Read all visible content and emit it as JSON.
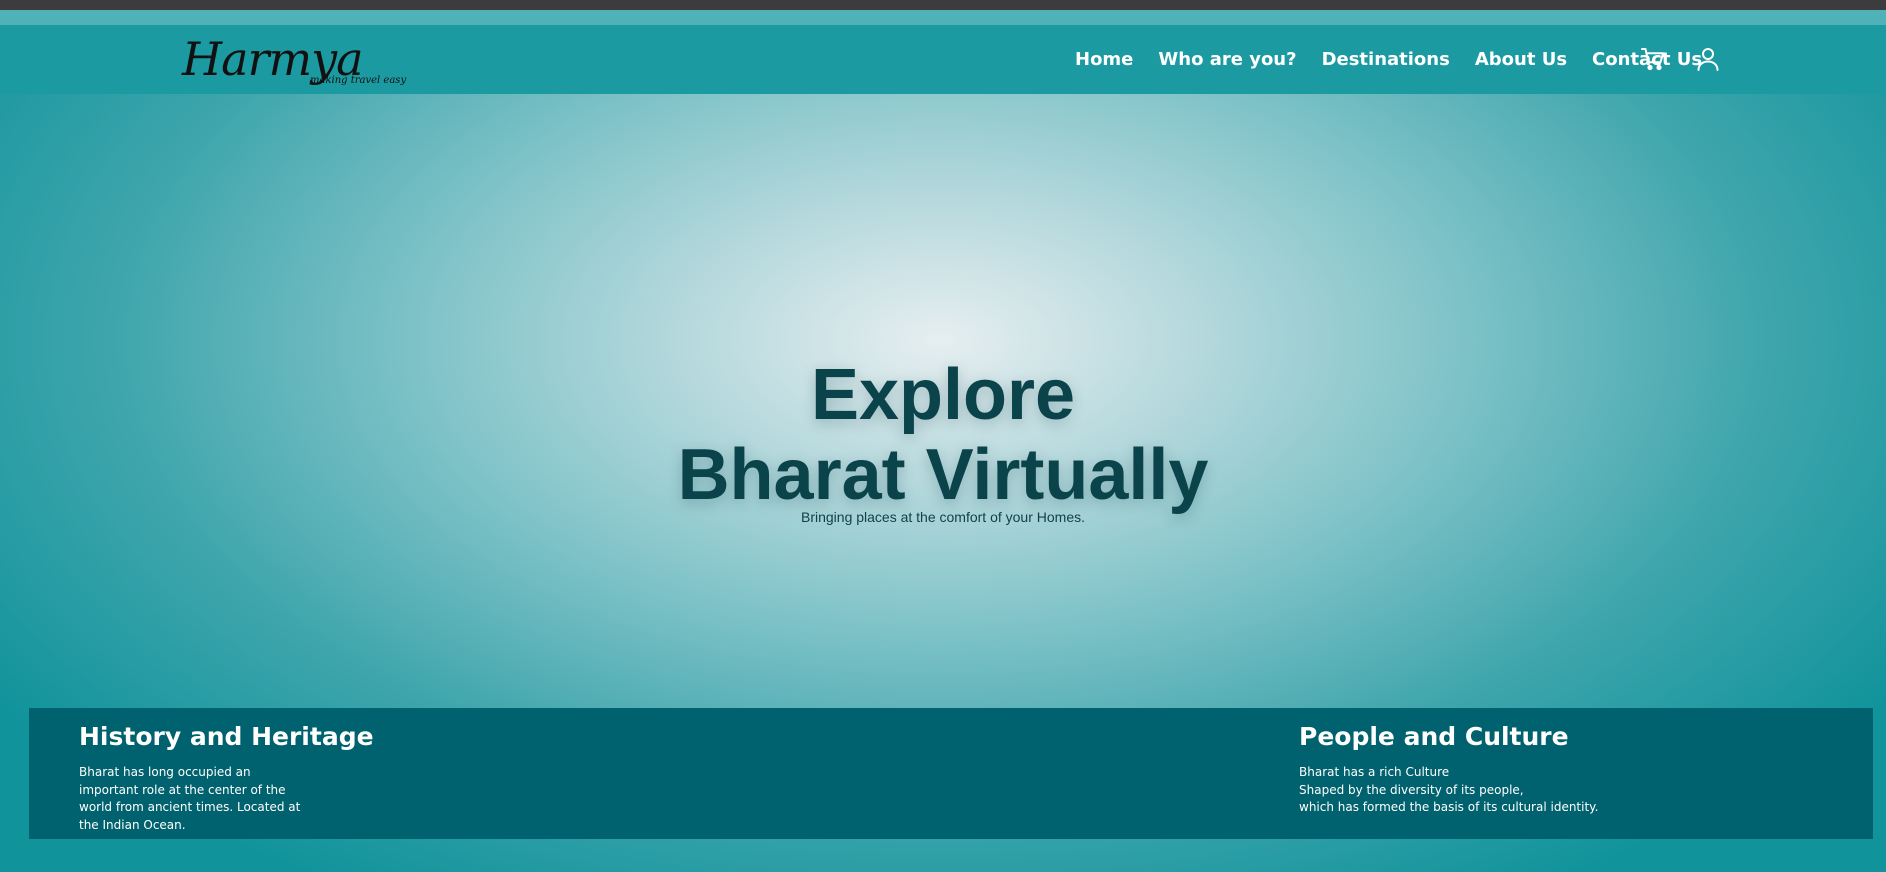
{
  "brand": {
    "name": "Harmya",
    "tagline": "making travel easy"
  },
  "nav": {
    "items": [
      "Home",
      "Who are you?",
      "Destinations",
      "About Us",
      "Contact Us"
    ],
    "icons": [
      "cart-icon",
      "user-icon"
    ]
  },
  "hero": {
    "title_line1": "Explore",
    "title_line2": "Bharat Virtually",
    "subtitle": "Bringing places at the comfort of your Homes."
  },
  "sections": {
    "history": {
      "title": "History and Heritage",
      "lines": [
        "Bharat has long occupied an",
        "important role at the center of the",
        "world from ancient times. Located at",
        "the Indian Ocean."
      ]
    },
    "culture": {
      "title": "People and Culture",
      "lines": [
        "Bharat has a rich Culture",
        "Shaped by the diversity of its people,",
        "which has formed the basis of its cultural identity."
      ]
    }
  },
  "colors": {
    "header": "#1b9aa2",
    "band": "#00626e",
    "heading": "#0b434b",
    "glow": "#e6eef0"
  }
}
